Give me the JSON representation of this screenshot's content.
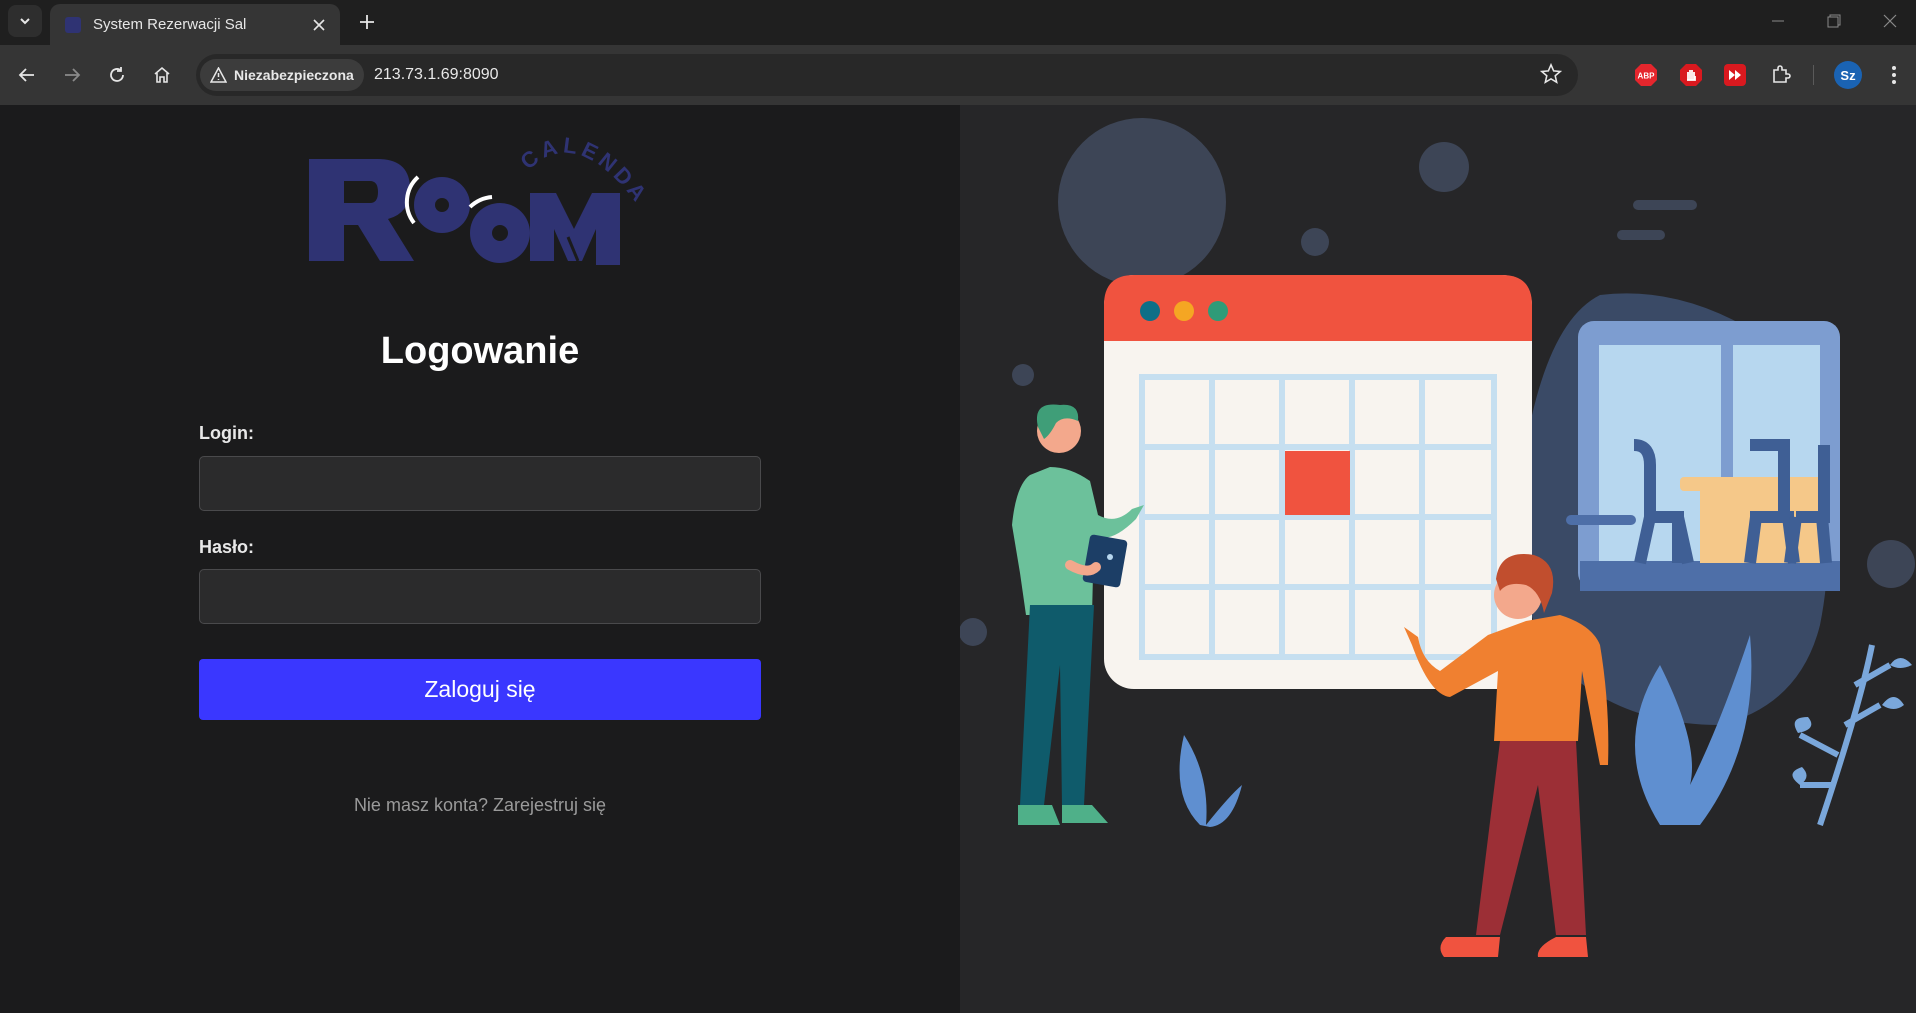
{
  "browser": {
    "tab_title": "System Rezerwacji Sal",
    "security_label": "Niezabezpieczona",
    "url": "213.73.1.69:8090",
    "profile_initials": "Sz",
    "extensions": [
      "abp-icon",
      "stop-hand-icon",
      "fast-forward-icon",
      "puzzle-icon"
    ]
  },
  "page": {
    "logo_text": "Room",
    "logo_subtext": "CALENDAR",
    "heading": "Logowanie",
    "login_label": "Login:",
    "login_value": "",
    "password_label": "Hasło:",
    "password_value": "",
    "submit_label": "Zaloguj się",
    "register_text": "Nie masz konta? Zarejestruj się"
  },
  "colors": {
    "accent_button": "#3a37ff",
    "logo_navy": "#2f3373",
    "calendar_red": "#f0533f"
  }
}
